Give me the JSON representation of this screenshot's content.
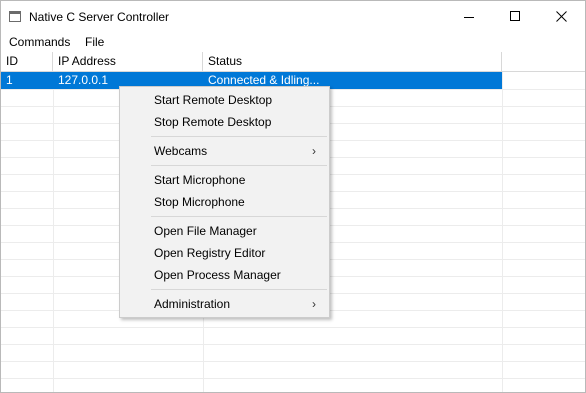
{
  "window": {
    "title": "Native C Server Controller"
  },
  "menubar": {
    "items": [
      {
        "label": "Commands"
      },
      {
        "label": "File"
      }
    ]
  },
  "list": {
    "columns": [
      "ID",
      "IP Address",
      "Status"
    ],
    "rows": [
      {
        "id": "1",
        "ip": "127.0.0.1",
        "status": "Connected & Idling...",
        "selected": true
      }
    ]
  },
  "context_menu": {
    "items": [
      {
        "label": "Start Remote Desktop"
      },
      {
        "label": "Stop Remote Desktop"
      },
      {
        "label": "Webcams",
        "submenu": true,
        "arrow": "›"
      },
      {
        "label": "Start Microphone"
      },
      {
        "label": "Stop Microphone"
      },
      {
        "label": "Open File Manager"
      },
      {
        "label": "Open Registry Editor"
      },
      {
        "label": "Open Process Manager"
      },
      {
        "label": "Administration",
        "submenu": true,
        "arrow": "›"
      }
    ]
  },
  "colors": {
    "selection": "#0078d7",
    "menu_background": "#f2f2f2"
  },
  "icons": {
    "app": "window-icon",
    "minimize": "minimize-icon",
    "maximize": "maximize-icon",
    "close": "close-icon",
    "submenu": "chevron-right-icon"
  }
}
